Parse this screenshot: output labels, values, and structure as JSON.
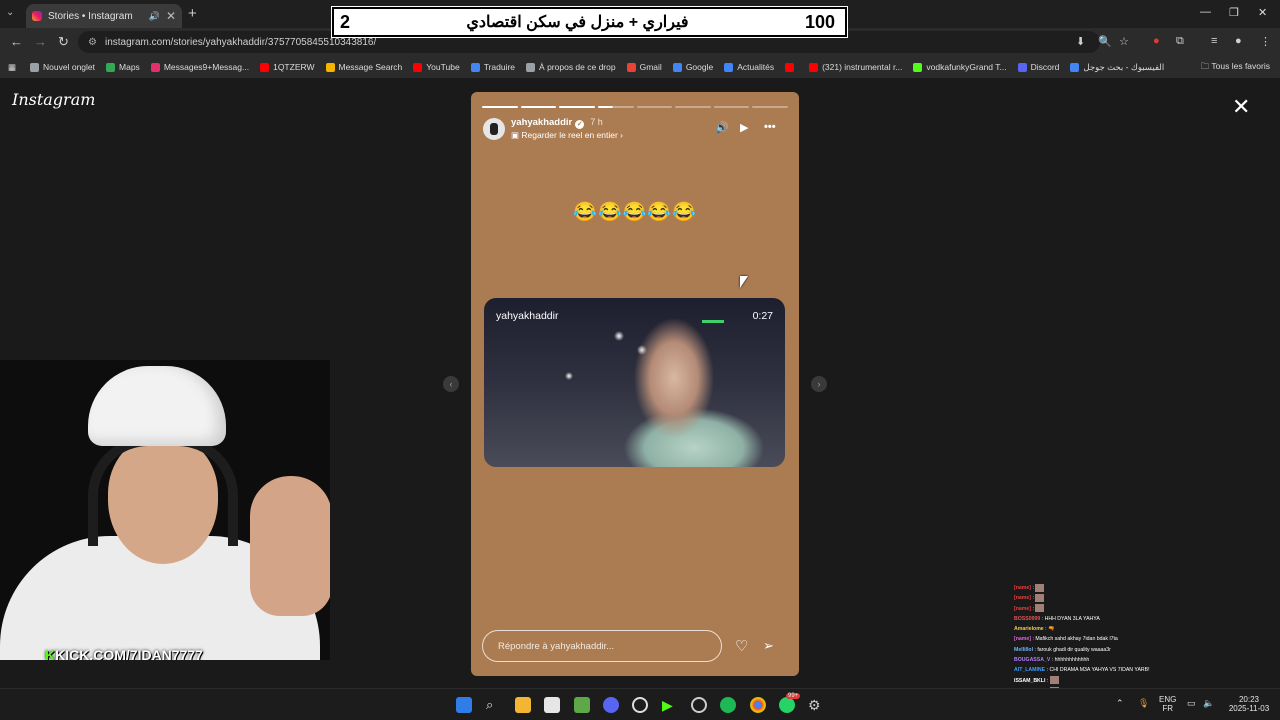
{
  "browser": {
    "tab_title": "Stories • Instagram",
    "url": "instagram.com/stories/yahyakhaddir/3757705845510343816/",
    "bookmarks": [
      {
        "label": "Nouvel onglet",
        "color": "#9aa0a6"
      },
      {
        "label": "Maps",
        "color": "#34a853"
      },
      {
        "label": "Messages9+Messag...",
        "color": "#e1306c"
      },
      {
        "label": "1QTZERW",
        "color": "#ff0000"
      },
      {
        "label": "Message Search",
        "color": "#f4b400"
      },
      {
        "label": "YouTube",
        "color": "#ff0000"
      },
      {
        "label": "Traduire",
        "color": "#4285f4"
      },
      {
        "label": "À propos de ce drop",
        "color": "#9aa0a6"
      },
      {
        "label": "Gmail",
        "color": "#ea4335"
      },
      {
        "label": "Google",
        "color": "#4285f4"
      },
      {
        "label": "Actualités",
        "color": "#4285f4"
      },
      {
        "label": "",
        "color": "#ff0000"
      },
      {
        "label": "(321) instrumental r...",
        "color": "#ff0000"
      },
      {
        "label": "vodkafunkyGrand T...",
        "color": "#53fc18"
      },
      {
        "label": "Discord",
        "color": "#5865f2"
      },
      {
        "label": "الفيسبوك - بحث جوجل",
        "color": "#4285f4"
      }
    ],
    "all_bookmarks": "Tous les favoris"
  },
  "banner": {
    "left_number": "2",
    "text": "فيراري + منزل في سكن اقتصادي",
    "right_number": "100"
  },
  "instagram": {
    "logo": "Instagram",
    "story": {
      "username": "yahyakhaddir",
      "age": "7 h",
      "reel_link": "Regarder le reel en entier",
      "emojis": "😂😂😂😂😂",
      "video_username": "yahyakhaddir",
      "video_time": "0:27",
      "reply_placeholder": "Répondre à yahyakhaddir...",
      "progress_segments": 8,
      "progress_done": 3
    }
  },
  "stream": {
    "kick_url": "KICK.COM/7IDAN7777",
    "kick_url_k": "K"
  },
  "chat": [
    {
      "user": "[name]",
      "msg": "",
      "emote": true,
      "color": "#e83d3d"
    },
    {
      "user": "[name]",
      "msg": "",
      "emote": true,
      "color": "#e83d3d"
    },
    {
      "user": "[name]",
      "msg": "",
      "emote": true,
      "color": "#e83d3d"
    },
    {
      "user": "BOSS0999",
      "msg": "HHH DYAN 3LA YAHYA",
      "emote": false,
      "color": "#e05555"
    },
    {
      "user": "Amarielome",
      "msg": "🔫",
      "emote": false,
      "color": "#f2c94c"
    },
    {
      "user": "[name]",
      "msg": "Mafikch sahd akhay 7idan bdak l7ta",
      "emote": false,
      "color": "#d864d8"
    },
    {
      "user": "Mellillol",
      "msg": "farouk ghadi dir quality waaaa3r",
      "emote": false,
      "color": "#6fb6ff"
    },
    {
      "user": "BOUGASSA_V",
      "msg": "hhhhhhhhhhhh",
      "emote": false,
      "color": "#b17bff"
    },
    {
      "user": "AIT_LAMINE",
      "msg": "CHI DRAMA M3A YAHYA VS 7IDAN YARB!",
      "emote": false,
      "color": "#3aa0ff"
    },
    {
      "user": "ISSAM_BKLI",
      "msg": "",
      "emote": true,
      "color": "#ffffff"
    },
    {
      "user": "ISSAM_BKLI",
      "msg": "",
      "emote": true,
      "color": "#ffffff"
    }
  ],
  "taskbar": {
    "lang_top": "ENG",
    "lang_bottom": "FR",
    "time": "20:23",
    "date": "2025-11-03",
    "discord_badge": "",
    "whatsapp_badge": "99+"
  },
  "colors": {
    "story_bg": "#ab7c52",
    "page_bg": "#1a1a1a",
    "kick_green": "#53fc18"
  }
}
